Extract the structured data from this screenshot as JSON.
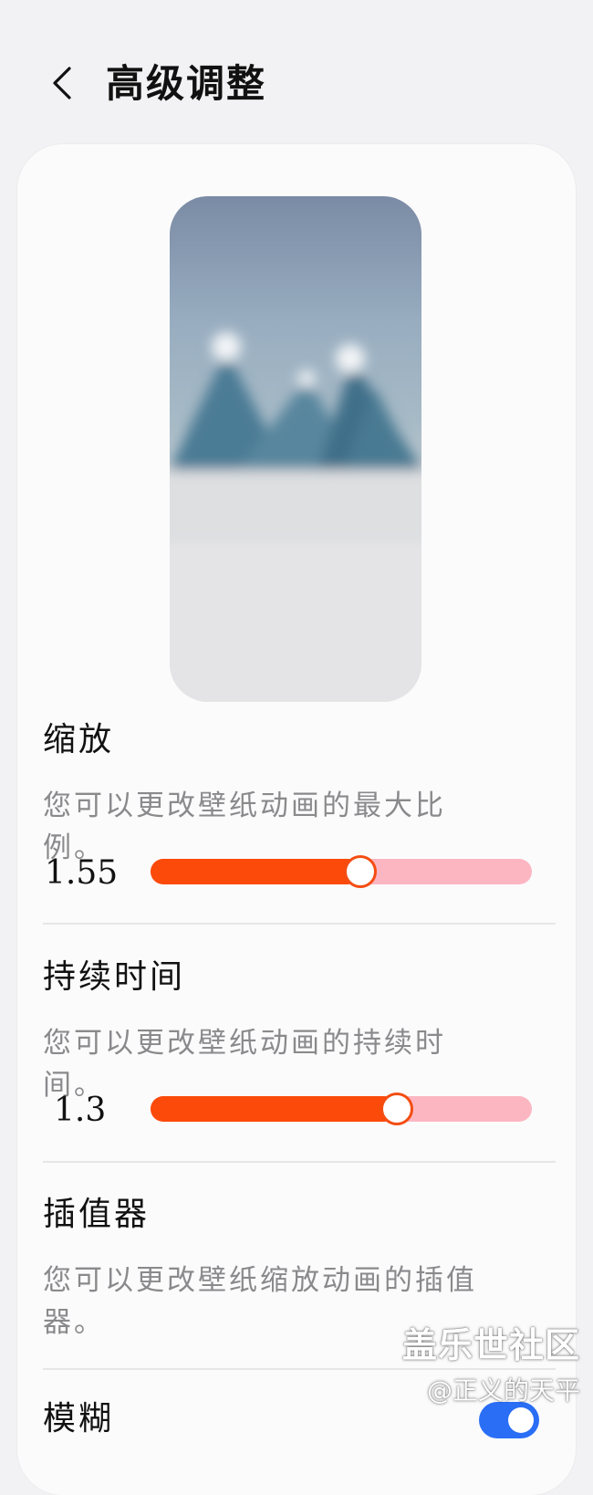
{
  "header": {
    "title": "高级调整"
  },
  "sections": [
    {
      "title": "缩放",
      "desc": "您可以更改壁纸动画的最大比例。",
      "value_label": "1.55",
      "fraction": 0.55
    },
    {
      "title": "持续时间",
      "desc": "您可以更改壁纸动画的持续时间。",
      "value_label": "1.3",
      "fraction": 0.645
    },
    {
      "title": "插值器",
      "desc": "您可以更改壁纸缩放动画的插值器。"
    },
    {
      "title": "模糊",
      "toggle_on": true
    }
  ],
  "icons": {
    "back": "chevron-left-icon"
  },
  "colors": {
    "accent": "#fb4a09",
    "track": "#fcb6c2",
    "toggle": "#2a6ef5"
  },
  "watermark": {
    "line1": "盖乐世社区",
    "line2": "@正义的天平"
  }
}
